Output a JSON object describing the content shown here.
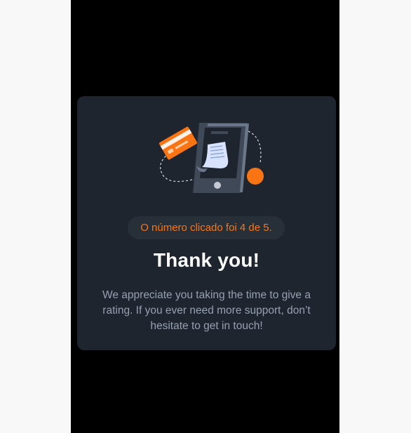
{
  "thank_you": {
    "selected_text": "O número clicado foi 4 de 5.",
    "title": "Thank you!",
    "message": "We appreciate you taking the time to give a rating. If you ever need more support, don’t hesitate to get in touch!"
  },
  "illustration": {
    "name": "thank-you-illustration",
    "icons": [
      "phone-icon",
      "credit-card-icon",
      "receipt-icon",
      "orange-dot-icon"
    ]
  },
  "colors": {
    "page_bg": "#f8f8f8",
    "frame_bg": "#000000",
    "card_bg": "#1f252e",
    "pill_bg": "#272f39",
    "accent": "#fb7413",
    "title": "#ffffff",
    "body_text": "#95a0b1"
  }
}
